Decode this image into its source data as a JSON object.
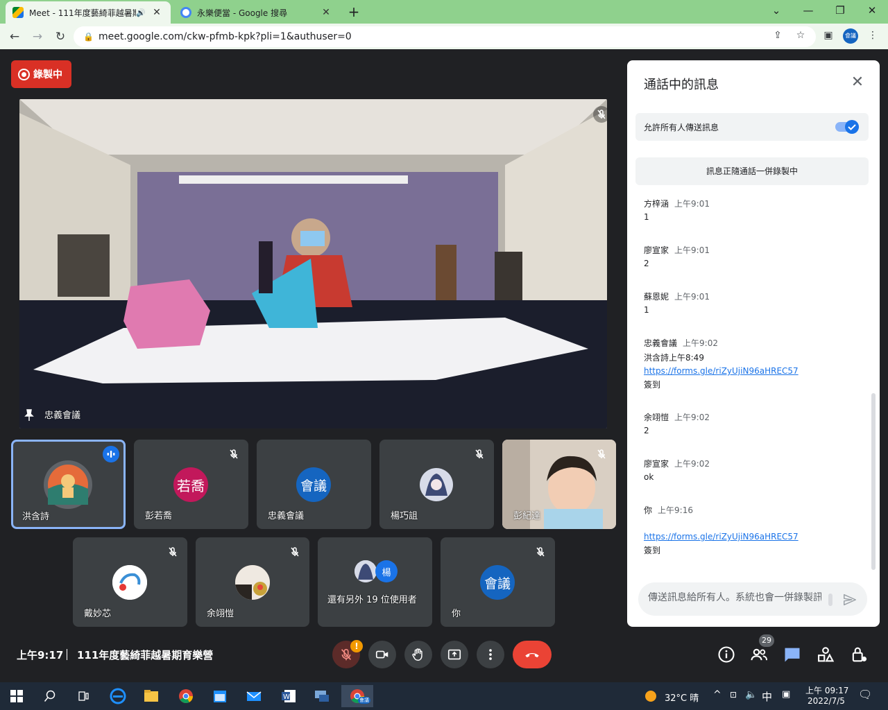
{
  "browser": {
    "tabs": [
      {
        "title": "Meet - 111年度藝綺菲越暑期",
        "active": true
      },
      {
        "title": "永樂便當 - Google 搜尋",
        "active": false
      }
    ],
    "url": "meet.google.com/ckw-pfmb-kpk?pli=1&authuser=0",
    "profile_label": "會議"
  },
  "recording": {
    "label": "錄製中"
  },
  "main_video": {
    "name": "忠義會議"
  },
  "tiles_row1": [
    {
      "name": "洪含詩",
      "avatar_text": "",
      "avatar_color": "#5f6368",
      "speaking": true
    },
    {
      "name": "彭若喬",
      "avatar_text": "若喬",
      "avatar_color": "#c2185b",
      "speaking": false
    },
    {
      "name": "忠義會議",
      "avatar_text": "會議",
      "avatar_color": "#1565c0",
      "speaking": false
    },
    {
      "name": "楊巧詛",
      "avatar_text": "",
      "avatar_color": "#2b3a55",
      "speaking": false
    },
    {
      "name": "彭紀達",
      "avatar_text": "",
      "avatar_color": "#c9b8a8",
      "speaking": false
    }
  ],
  "tiles_row2": [
    {
      "name": "戴妙芯",
      "avatar_text": "",
      "avatar_color": "#ffffff"
    },
    {
      "name": "余翊愷",
      "avatar_text": "",
      "avatar_color": "#8a7a6a"
    },
    {
      "name": "還有另外 19 位使用者",
      "avatar_text": "楊",
      "avatar_color": "#1a73e8"
    },
    {
      "name": "你",
      "avatar_text": "會議",
      "avatar_color": "#1565c0"
    }
  ],
  "chat": {
    "title": "通話中的訊息",
    "allow_label": "允許所有人傳送訊息",
    "recording_note": "訊息正隨通話一併錄製中",
    "messages": [
      {
        "sender": "方梓涵",
        "time": "上午9:01",
        "lines": [
          "1"
        ]
      },
      {
        "sender": "廖宣家",
        "time": "上午9:01",
        "lines": [
          "2"
        ]
      },
      {
        "sender": "蘇恩妮",
        "time": "上午9:01",
        "lines": [
          "1"
        ]
      },
      {
        "sender": "忠義會議",
        "time": "上午9:02",
        "lines": [
          "洪含詩上午8:49"
        ],
        "link": "https://forms.gle/riZyUjiN96aHREC57",
        "after": "簽到"
      },
      {
        "sender": "余翊愷",
        "time": "上午9:02",
        "lines": [
          "2"
        ]
      },
      {
        "sender": "廖宣家",
        "time": "上午9:02",
        "lines": [
          "ok"
        ]
      },
      {
        "sender": "你",
        "time": "上午9:16",
        "lines": [
          ""
        ],
        "link": "https://forms.gle/riZyUjiN96aHREC57",
        "after": "簽到"
      }
    ],
    "input_placeholder": "傳送訊息給所有人。系統也會一併錄製訊"
  },
  "bottom": {
    "time": "上午9:17",
    "meeting_name": "111年度藝綺菲越暑期育樂營",
    "mic_alert": "!",
    "participants_count": "29"
  },
  "taskbar": {
    "weather": "32°C 晴",
    "ime": "中",
    "time": "上午 09:17",
    "date": "2022/7/5",
    "chrome_label": "會議"
  }
}
